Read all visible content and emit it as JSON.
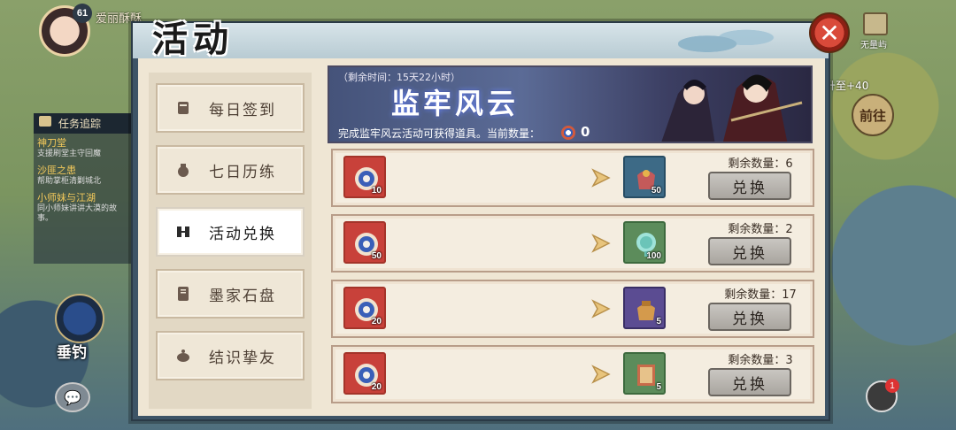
{
  "hud": {
    "level": "61",
    "player_name": "爱丽酥酥",
    "fish_label": "垂钓",
    "right_shortcut_label": "无量屿",
    "goto_hint": "升至+40",
    "goto_label": "前往",
    "notify_count": "1"
  },
  "quest_tracker": {
    "title": "任务追踪",
    "items": [
      {
        "name": "神刀堂",
        "desc": "支援刷堂主守回魔"
      },
      {
        "name": "沙匪之患",
        "desc": "帮助掌柜清剿城北"
      },
      {
        "name": "小师妹与江湖",
        "desc": "同小师妹讲讲大漠的故事。"
      }
    ]
  },
  "dialog": {
    "title": "活动",
    "close_label": "✕"
  },
  "sidebar": {
    "items": [
      {
        "label": "每日签到",
        "icon": "scroll-icon"
      },
      {
        "label": "七日历练",
        "icon": "pouch-icon"
      },
      {
        "label": "活动兑换",
        "icon": "exchange-icon",
        "active": true
      },
      {
        "label": "墨家石盘",
        "icon": "stone-tablet-icon"
      },
      {
        "label": "结识挚友",
        "icon": "teapot-icon"
      }
    ]
  },
  "banner": {
    "remaining_time": "（剩余时间：15天22小时）",
    "title": "监牢风云",
    "description": "完成监牢风云活动可获得道具。当前数量：",
    "current_count": "0"
  },
  "exchange": {
    "remaining_prefix": "剩余数量：",
    "button_label": "兑换",
    "rows": [
      {
        "cost_qty": "10",
        "reward_qty": "50",
        "reward_icon": "gift-bag-icon",
        "remaining": "6"
      },
      {
        "cost_qty": "50",
        "reward_qty": "100",
        "reward_icon": "jade-orb-icon",
        "remaining": "2"
      },
      {
        "cost_qty": "20",
        "reward_qty": "5",
        "reward_icon": "money-pouch-icon",
        "remaining": "17"
      },
      {
        "cost_qty": "20",
        "reward_qty": "5",
        "reward_icon": "book-icon",
        "remaining": "3"
      }
    ]
  },
  "colors": {
    "frame": "#3d5466",
    "paper": "#efe6d4",
    "banner": "#45537a",
    "token_red": "#c8413a",
    "close_red": "#d94a3a"
  }
}
